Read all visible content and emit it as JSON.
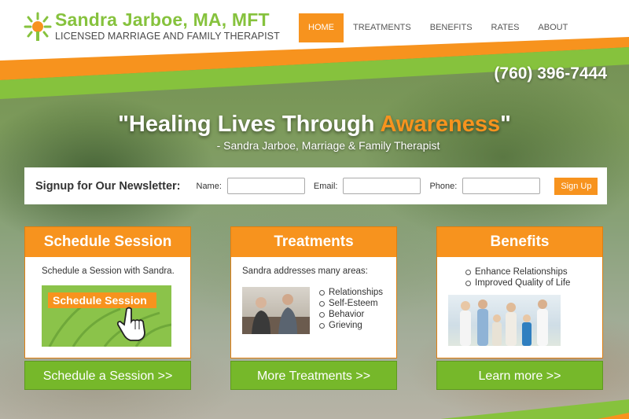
{
  "brand": {
    "name": "Sandra Jarboe, MA, MFT",
    "tagline": "LICENSED MARRIAGE AND FAMILY THERAPIST",
    "green": "#86c23d",
    "orange": "#f7931e"
  },
  "nav": {
    "items": [
      {
        "label": "HOME",
        "active": true
      },
      {
        "label": "TREATMENTS",
        "active": false
      },
      {
        "label": "BENEFITS",
        "active": false
      },
      {
        "label": "RATES",
        "active": false
      },
      {
        "label": "ABOUT",
        "active": false
      }
    ]
  },
  "phone": "(760) 396-7444",
  "hero": {
    "quote_start": "\"Healing Lives Through ",
    "quote_accent": "Awareness",
    "quote_end": "\"",
    "subtitle": "- Sandra Jarboe, Marriage & Family Therapist"
  },
  "newsletter": {
    "title": "Signup for Our Newsletter:",
    "name_label": "Name:",
    "email_label": "Email:",
    "phone_label": "Phone:",
    "button": "Sign Up",
    "name_value": "",
    "email_value": "",
    "phone_value": ""
  },
  "cards": [
    {
      "title": "Schedule Session",
      "body": "Schedule a Session with Sandra.",
      "image_label": "Schedule Session",
      "button": "Schedule a Session >>"
    },
    {
      "title": "Treatments",
      "body": "Sandra addresses many areas:",
      "items": [
        "Relationships",
        "Self-Esteem",
        "Behavior",
        "Grieving"
      ],
      "button": "More Treatments >>"
    },
    {
      "title": "Benefits",
      "items": [
        "Enhance Relationships",
        "Improved Quality of Life"
      ],
      "button": "Learn more >>"
    }
  ]
}
